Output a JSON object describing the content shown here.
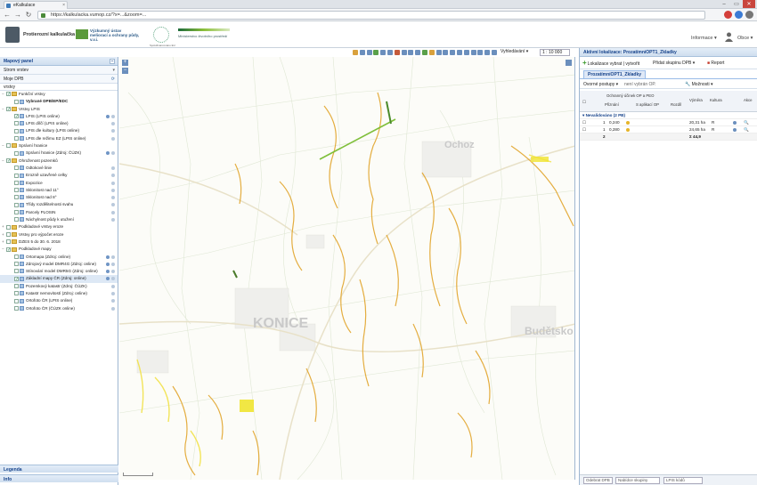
{
  "browser": {
    "tab_title": "eKalkulace",
    "url": "https://kalkulacka.vumop.cz/?x=...&zoom=...",
    "window_controls": [
      "–",
      "▭",
      "✕"
    ]
  },
  "header": {
    "app_name": "Protierozní kalkulačka",
    "org_name": "Výzkumný ústav meliorací a ochrany půdy, v.v.i.",
    "partner_note": "Spolufinancováno EU",
    "program_label": "Ministerstvo životního prostředí",
    "info_menu": "Informace ▾",
    "user_name": "Obce ▾"
  },
  "toolbar": {
    "scale_dropdown": "Vyhledávání ▾",
    "scale_value": "1 : 10 000",
    "icon_colors": [
      "#d9a13c",
      "#6b8fbd",
      "#6b8fbd",
      "#5aa04a",
      "#6b8fbd",
      "#6b8fbd",
      "#c45a3a",
      "#6b8fbd",
      "#6b8fbd",
      "#6b8fbd",
      "#5aa04a",
      "#d9a13c",
      "#6b8fbd",
      "#6b8fbd",
      "#6b8fbd",
      "#6b8fbd",
      "#6b8fbd",
      "#6b8fbd",
      "#6b8fbd",
      "#6b8fbd",
      "#6b8fbd"
    ]
  },
  "left_panel": {
    "title": "Mapový panel",
    "tree_header": "Strom vrstev",
    "my_layers": "Moje DPB",
    "column_label": "vrstvy",
    "footer_legend": "Legenda",
    "footer_info": "Info",
    "tree": [
      {
        "indent": 0,
        "exp": "−",
        "chk": true,
        "type": "folder",
        "label": "Funkční vrstvy",
        "icons": 0
      },
      {
        "indent": 1,
        "exp": "",
        "chk": false,
        "type": "lay",
        "label": "Vybrané DPB/EP/EDC",
        "icons": 0,
        "bold": true
      },
      {
        "indent": 0,
        "exp": "−",
        "chk": true,
        "type": "folder",
        "label": "Vrstvy LPIS",
        "icons": 0
      },
      {
        "indent": 1,
        "exp": "",
        "chk": true,
        "type": "lay",
        "label": "LPIS (LPIS online)",
        "icons": 2
      },
      {
        "indent": 1,
        "exp": "",
        "chk": false,
        "type": "lay",
        "label": "LPIS dílčí (LPIS online)",
        "icons": 1
      },
      {
        "indent": 1,
        "exp": "",
        "chk": false,
        "type": "lay",
        "label": "LPIS dle kultury (LPIS online)",
        "icons": 1
      },
      {
        "indent": 1,
        "exp": "",
        "chk": false,
        "type": "lay",
        "label": "LPIS dle režimu EZ (LPIS online)",
        "icons": 1
      },
      {
        "indent": 0,
        "exp": "−",
        "chk": false,
        "type": "folder",
        "label": "Správní hranice",
        "icons": 0
      },
      {
        "indent": 1,
        "exp": "",
        "chk": false,
        "type": "lay",
        "label": "Správní hranice (Zdroj: ČÚZK)",
        "icons": 2
      },
      {
        "indent": 0,
        "exp": "−",
        "chk": true,
        "type": "folder",
        "label": "Ohroženost pozemků",
        "icons": 0
      },
      {
        "indent": 1,
        "exp": "",
        "chk": false,
        "type": "lay",
        "label": "Odtokové linie",
        "icons": 1
      },
      {
        "indent": 1,
        "exp": "",
        "chk": false,
        "type": "lay",
        "label": "Erozně uzavřené celky",
        "icons": 1
      },
      {
        "indent": 1,
        "exp": "",
        "chk": false,
        "type": "lay",
        "label": "Expozice",
        "icons": 1
      },
      {
        "indent": 1,
        "exp": "",
        "chk": false,
        "type": "lay",
        "label": "Sklonitost nad 11°",
        "icons": 1
      },
      {
        "indent": 1,
        "exp": "",
        "chk": false,
        "type": "lay",
        "label": "Sklonitost nad 8°",
        "icons": 1
      },
      {
        "indent": 1,
        "exp": "",
        "chk": false,
        "type": "lay",
        "label": "Třídy rozdělitelnosti svahu",
        "icons": 1
      },
      {
        "indent": 1,
        "exp": "",
        "chk": false,
        "type": "lay",
        "label": "Parcely PLOSIN",
        "icons": 1
      },
      {
        "indent": 1,
        "exp": "",
        "chk": false,
        "type": "lay",
        "label": "Náchylnost půdy k utužení",
        "icons": 1
      },
      {
        "indent": 0,
        "exp": "+",
        "chk": false,
        "type": "folder",
        "label": "Podkladové vrstvy eroze",
        "icons": 0
      },
      {
        "indent": 0,
        "exp": "+",
        "chk": false,
        "type": "folder",
        "label": "Vrstvy pro výpočet eroze",
        "icons": 0
      },
      {
        "indent": 0,
        "exp": "+",
        "chk": false,
        "type": "folder",
        "label": "DZES 5 do 30. 6. 2018",
        "icons": 0
      },
      {
        "indent": 0,
        "exp": "−",
        "chk": true,
        "type": "folder",
        "label": "Podkladové mapy",
        "icons": 0
      },
      {
        "indent": 1,
        "exp": "",
        "chk": false,
        "type": "lay",
        "label": "Ortomapa (Zdroj: online)",
        "icons": 2
      },
      {
        "indent": 1,
        "exp": "",
        "chk": false,
        "type": "lay",
        "label": "Zdrojový model DMR4G (Zdroj: online)",
        "icons": 2
      },
      {
        "indent": 1,
        "exp": "",
        "chk": false,
        "type": "lay",
        "label": "Stínování model DMR5G (Zdroj: online)",
        "icons": 2
      },
      {
        "indent": 1,
        "exp": "",
        "chk": true,
        "type": "lay",
        "label": "Základní mapy ČR (Zdroj: online)",
        "icons": 2,
        "sel": true
      },
      {
        "indent": 1,
        "exp": "",
        "chk": false,
        "type": "lay",
        "label": "Pozemkový katastr (Zdroj: ČÚZK)",
        "icons": 1
      },
      {
        "indent": 1,
        "exp": "",
        "chk": false,
        "type": "lay",
        "label": "Katastr nemovitostí (Zdroj: online)",
        "icons": 1
      },
      {
        "indent": 1,
        "exp": "",
        "chk": false,
        "type": "lay",
        "label": "Ortofoto ČR (LPIS online)",
        "icons": 1
      },
      {
        "indent": 1,
        "exp": "",
        "chk": false,
        "type": "lay",
        "label": "Ortofoto ČR (ČÚZK online)",
        "icons": 1
      }
    ]
  },
  "map": {
    "labels": [
      "KONICE",
      "Ochoz",
      "Budětsko"
    ]
  },
  "right_panel": {
    "title": "Aktivní lokalizace: ProzatímníOPT1_Zkladky",
    "add_button": "Lokalizace vybrat | vytvořit",
    "group_button": "Přidat skupinu DPB ▾",
    "report_button": "Report",
    "tab_label": "ProzatímníOPT1_Zkladky",
    "actions_menu": "Ovorné postupy ▾",
    "actions_hint": "není vybrán OP.",
    "options_menu": "Možnosti ▾",
    "grid_head": {
      "protection": "Ochranný účinek OP a PEO",
      "current": "Přiznání",
      "with_op": "S aplikací OP",
      "reduction": "Rozdíl",
      "area": "Výměra",
      "culture": "Kultura",
      "actions": "Akce"
    },
    "group_label": "Nevalidováno (2 PB)",
    "rows": [
      {
        "n": "1",
        "val": "0,240",
        "area": "20,31 ha",
        "culture": "R"
      },
      {
        "n": "1",
        "val": "0,280",
        "area": "24,65 ha",
        "culture": "R"
      }
    ],
    "sum": {
      "n": "2",
      "area": "Σ 44,9"
    },
    "bottom": {
      "btn1": "Odebrat DPB",
      "select1": "Nabídce skupiny",
      "select2": "LPIS kódů"
    }
  }
}
